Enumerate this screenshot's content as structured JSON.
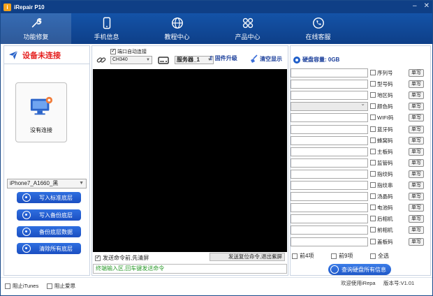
{
  "app": {
    "title": "iRepair P10",
    "logo_letter": "i"
  },
  "nav": [
    {
      "label": "功能修复",
      "icon": "repair-icon"
    },
    {
      "label": "手机信息",
      "icon": "phone-icon"
    },
    {
      "label": "教程中心",
      "icon": "globe-icon"
    },
    {
      "label": "产品中心",
      "icon": "product-icon"
    },
    {
      "label": "在线客服",
      "icon": "phone-call-icon"
    }
  ],
  "left": {
    "status": "设备未连接",
    "device_label": "没有连接",
    "model_selected": "iPhone7_A1660_黑",
    "buttons": [
      "写入标准底层",
      "写入备份底层",
      "备份底层数据",
      "清除所有底层"
    ]
  },
  "mid": {
    "port_auto_connect": "端口自动连接",
    "port_selected": "CH340",
    "server_selected": "服务器_1",
    "firmware_upgrade": "固件升级",
    "clear_display": "清空显示",
    "send_clear_label": "发送命令前,先清屏",
    "reset_button": "发送复位命令,退出紫屏",
    "cmd_placeholder": "终端输入区,回车键发送命令"
  },
  "right": {
    "disk_capacity": "硬盘容量: 0GB",
    "write_label": "单写",
    "fields": [
      {
        "label": "序列号",
        "dropdown": false
      },
      {
        "label": "型号码",
        "dropdown": false
      },
      {
        "label": "地区码",
        "dropdown": false
      },
      {
        "label": "颜色码",
        "dropdown": true
      },
      {
        "label": "WIFI码",
        "dropdown": false
      },
      {
        "label": "蓝牙码",
        "dropdown": false
      },
      {
        "label": "蜂窝码",
        "dropdown": false
      },
      {
        "label": "主板码",
        "dropdown": false
      },
      {
        "label": "监管码",
        "dropdown": false
      },
      {
        "label": "指纹码",
        "dropdown": false
      },
      {
        "label": "指纹串",
        "dropdown": false
      },
      {
        "label": "汤晶码",
        "dropdown": false
      },
      {
        "label": "电池码",
        "dropdown": false
      },
      {
        "label": "后相机",
        "dropdown": false
      },
      {
        "label": "前相机",
        "dropdown": false
      },
      {
        "label": "盖板码",
        "dropdown": false
      }
    ],
    "bulk": [
      "前4项",
      "前9项",
      "全选"
    ],
    "query_button": "查询硬盘所有信息"
  },
  "status": {
    "block_itunes": "阻止iTunes",
    "block_aisi": "阻止爱思",
    "welcome": "欢迎使用iRepa",
    "version": "版本号:V1.01"
  },
  "colors": {
    "nav_bg": "#1453a8",
    "titlebar": "#0f3f86",
    "alert": "#e5201f",
    "button": "#1b4fc2"
  }
}
